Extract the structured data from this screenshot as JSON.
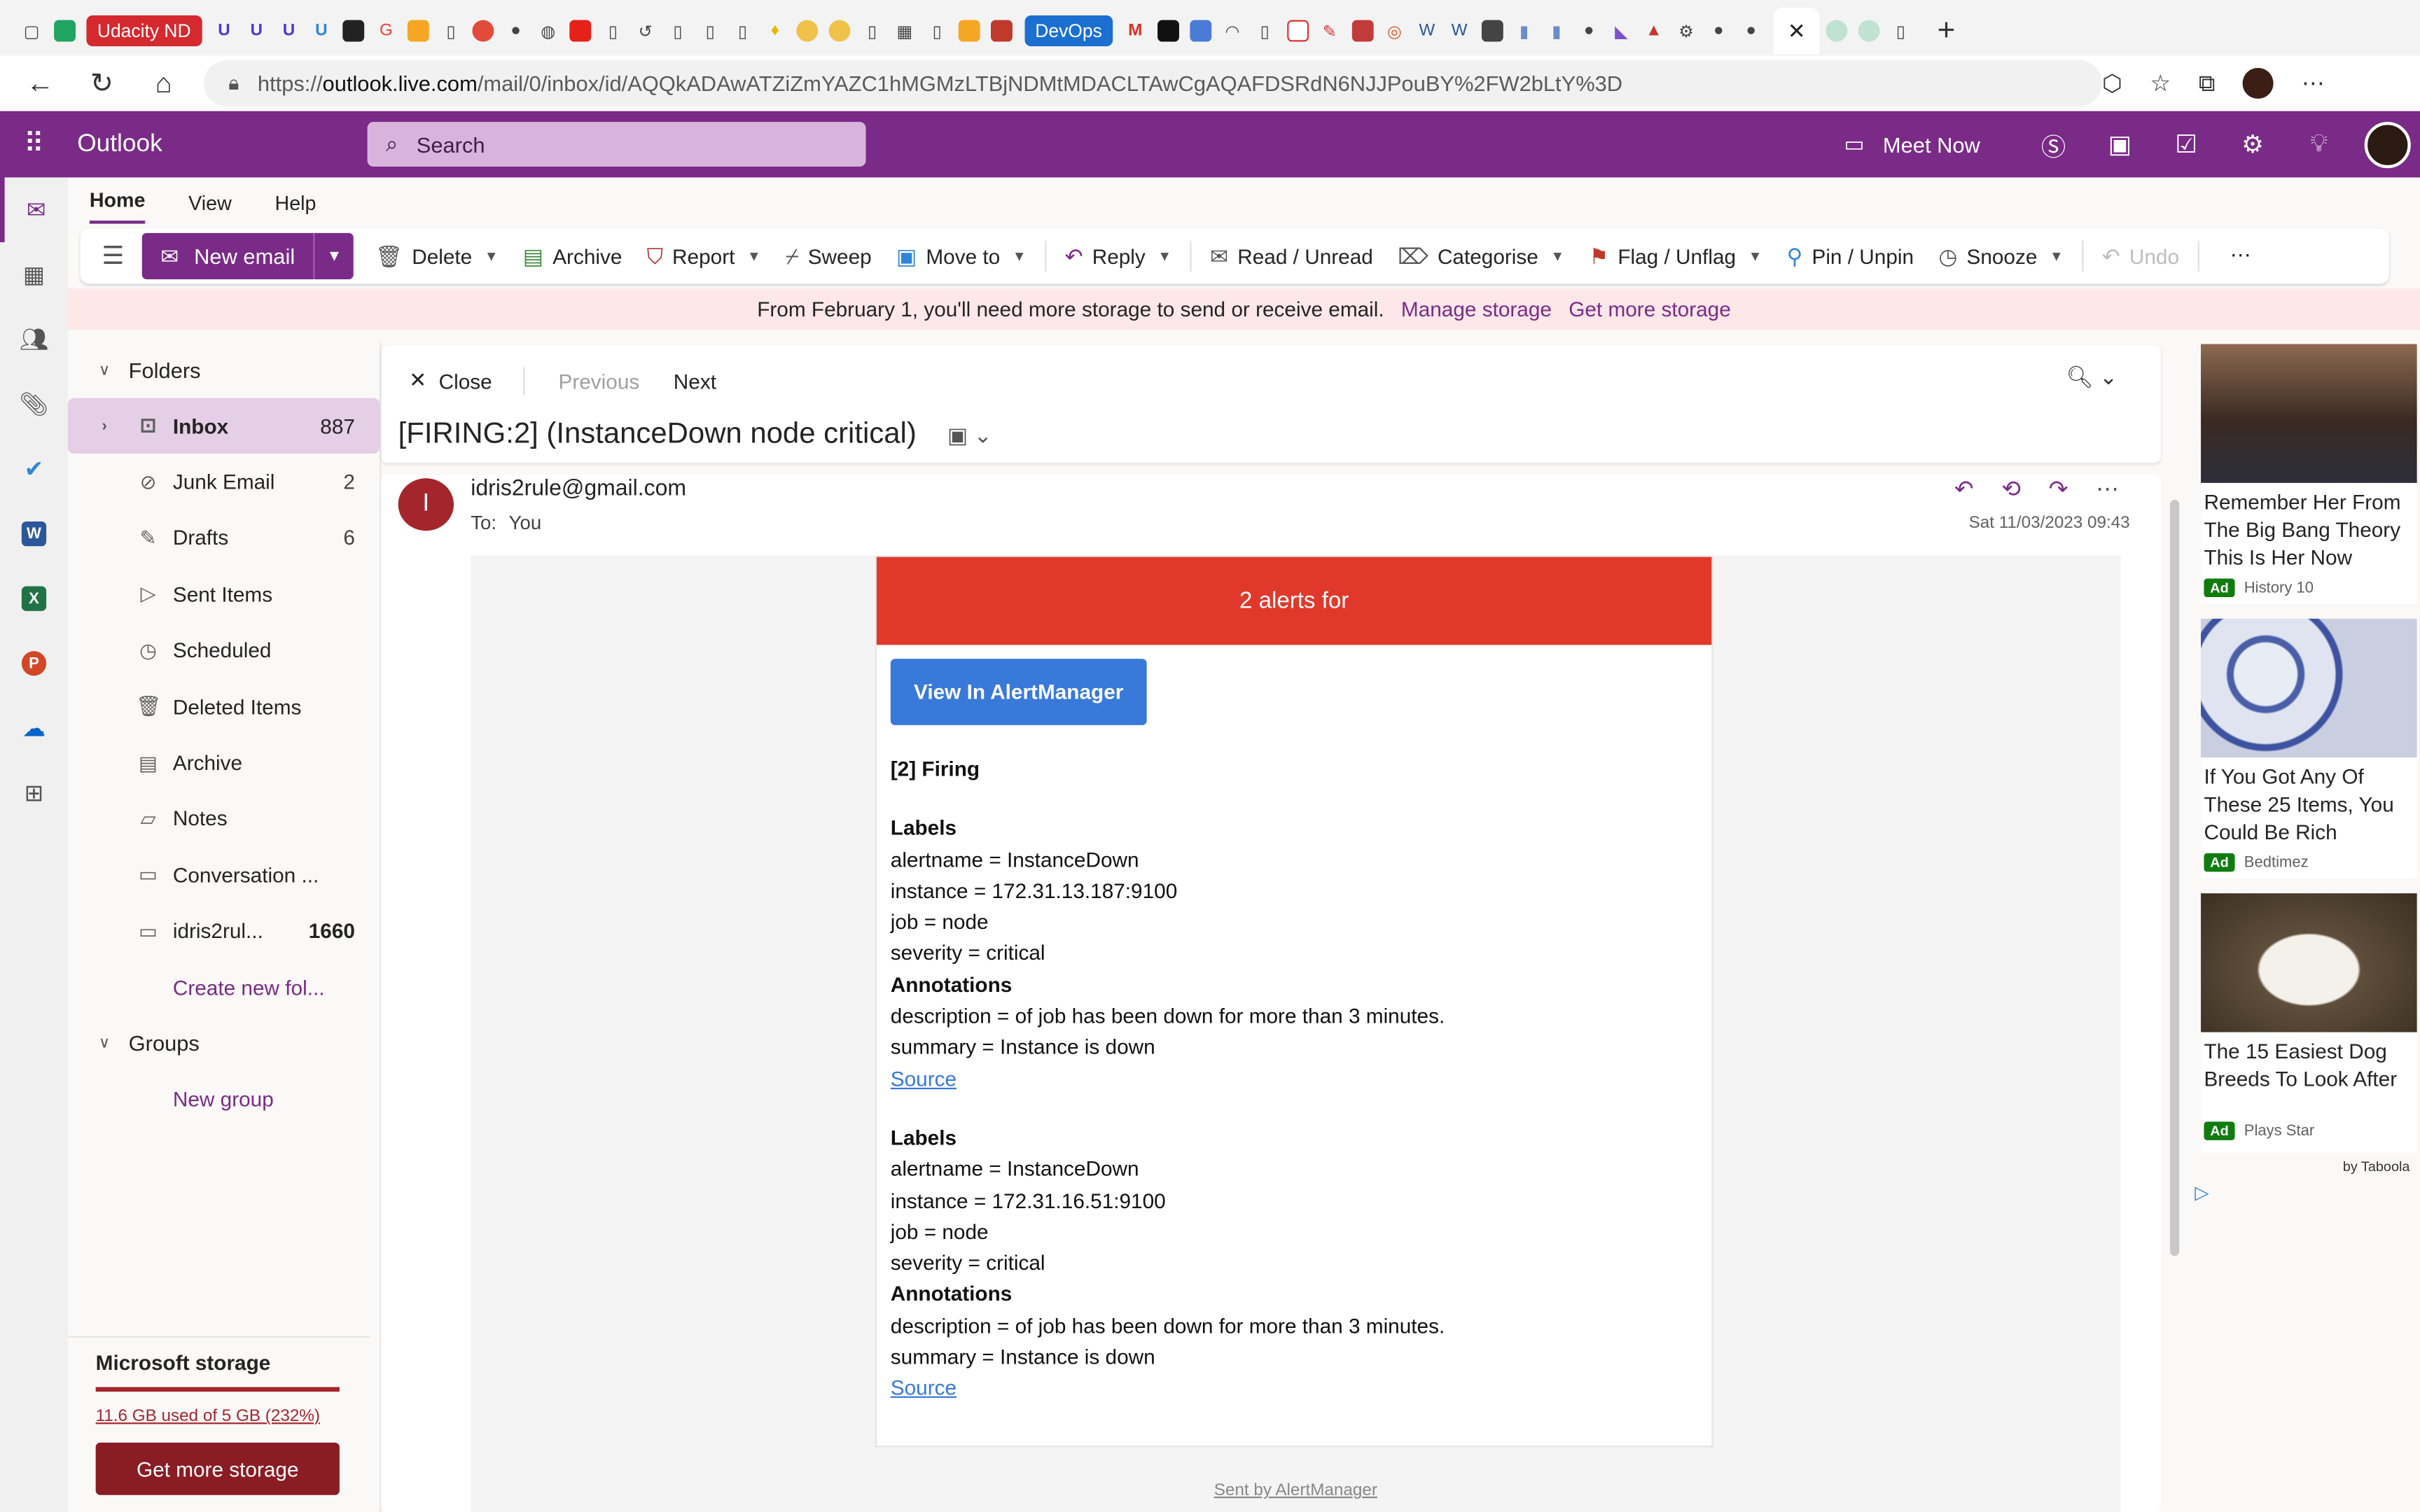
{
  "browser": {
    "tabs_pinned": [
      "Udacity ND",
      "DevOps"
    ],
    "url_prefix": "https://",
    "url_host": "outlook.live.com",
    "url_path": "/mail/0/inbox/id/AQQkADAwATZiZmYAZC1hMGMzLTBjNDMtMDACLTAwCgAQAFDSRdN6NJJPouBY%2FW2bLtY%3D"
  },
  "app": {
    "name": "Outlook",
    "search_placeholder": "Search",
    "meet_now": "Meet Now"
  },
  "ribbon": {
    "tabs": [
      "Home",
      "View",
      "Help"
    ],
    "new_email": "New email",
    "delete": "Delete",
    "archive": "Archive",
    "report": "Report",
    "sweep": "Sweep",
    "move_to": "Move to",
    "reply": "Reply",
    "read_unread": "Read / Unread",
    "categorise": "Categorise",
    "flag": "Flag / Unflag",
    "pin": "Pin / Unpin",
    "snooze": "Snooze",
    "undo": "Undo"
  },
  "banner": {
    "message": "From February 1, you'll need more storage to send or receive email.",
    "manage": "Manage storage",
    "get_more": "Get more storage"
  },
  "folders": {
    "header": "Folders",
    "items": [
      {
        "label": "Inbox",
        "count": "887"
      },
      {
        "label": "Junk Email",
        "count": "2"
      },
      {
        "label": "Drafts",
        "count": "6"
      },
      {
        "label": "Sent Items",
        "count": ""
      },
      {
        "label": "Scheduled",
        "count": ""
      },
      {
        "label": "Deleted Items",
        "count": ""
      },
      {
        "label": "Archive",
        "count": ""
      },
      {
        "label": "Notes",
        "count": ""
      },
      {
        "label": "Conversation ...",
        "count": ""
      },
      {
        "label": "idris2rul...",
        "count": "1660"
      }
    ],
    "create_new": "Create new fol...",
    "groups_header": "Groups",
    "new_group": "New group"
  },
  "storage": {
    "title": "Microsoft storage",
    "used": "11.6 GB used of 5 GB (232%)",
    "button": "Get more storage",
    "percent": 232
  },
  "reading": {
    "close": "Close",
    "previous": "Previous",
    "next": "Next",
    "subject": "[FIRING:2] (InstanceDown node critical)",
    "sender_initial": "I",
    "sender": "idris2rule@gmail.com",
    "to_label": "To:",
    "to": "You",
    "date": "Sat 11/03/2023 09:43"
  },
  "email": {
    "header": "2 alerts for",
    "button": "View In AlertManager",
    "firing": "[2] Firing",
    "alerts": [
      {
        "labels_title": "Labels",
        "alertname": "alertname = InstanceDown",
        "instance": "instance = 172.31.13.187:9100",
        "job": "job = node",
        "severity": "severity = critical",
        "annotations_title": "Annotations",
        "description": "description = of job has been down for more than 3 minutes.",
        "summary": "summary = Instance is down",
        "source": "Source"
      },
      {
        "labels_title": "Labels",
        "alertname": "alertname = InstanceDown",
        "instance": "instance = 172.31.16.51:9100",
        "job": "job = node",
        "severity": "severity = critical",
        "annotations_title": "Annotations",
        "description": "description = of job has been down for more than 3 minutes.",
        "summary": "summary = Instance is down",
        "source": "Source"
      }
    ],
    "footer": "Sent by AlertManager"
  },
  "ads": {
    "items": [
      {
        "title": "Remember Her From The Big Bang Theory This Is Her Now",
        "badge": "Ad",
        "source": "History 10"
      },
      {
        "title": "If You Got Any Of These 25 Items, You Could Be Rich",
        "badge": "Ad",
        "source": "Bedtimez"
      },
      {
        "title": "The 15 Easiest Dog Breeds To Look After",
        "badge": "Ad",
        "source": "Plays Star"
      }
    ],
    "by": "by Taboola"
  },
  "colors": {
    "brand": "#7a2a87",
    "alert_header": "#e0392b",
    "alert_button": "#3879d9",
    "storage_warning": "#a4262c"
  }
}
